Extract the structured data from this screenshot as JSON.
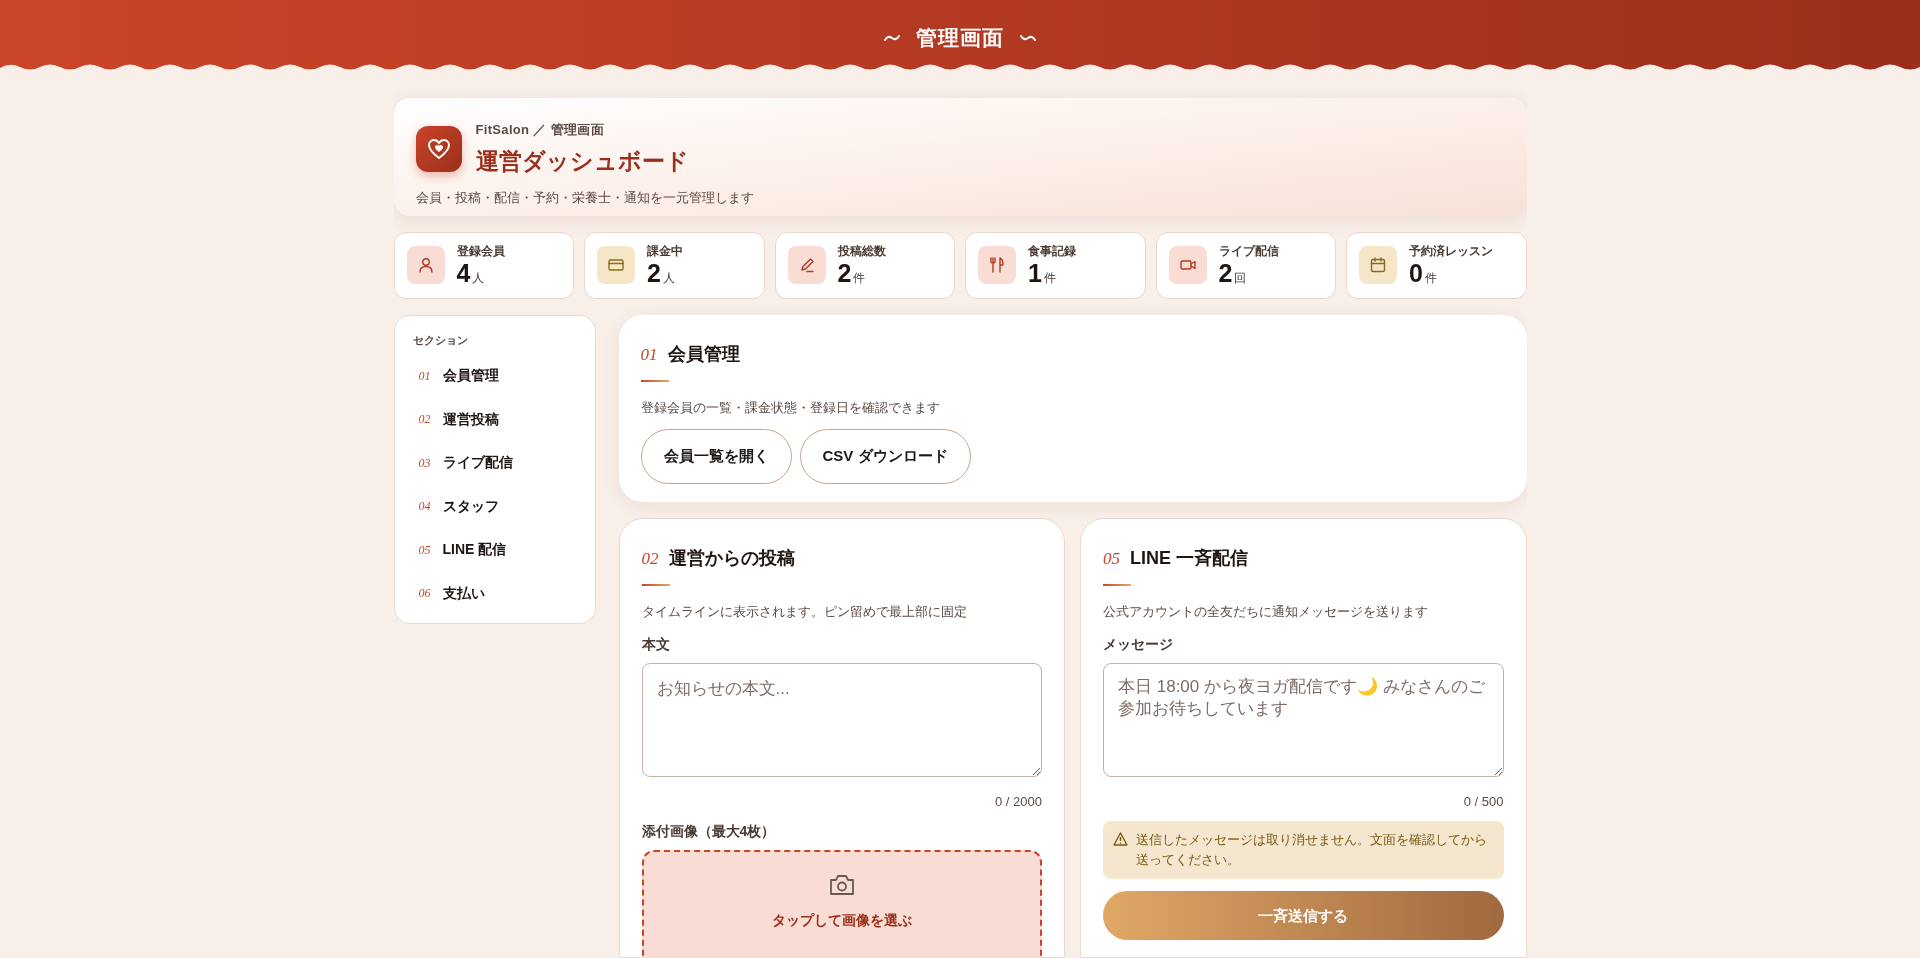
{
  "header": {
    "title": "管理画面"
  },
  "overview": {
    "breadcrumb": "FitSalon ／ 管理画面",
    "title": "運営ダッシュボード",
    "subtitle": "会員・投稿・配信・予約・栄養士・通知を一元管理します"
  },
  "stats": [
    {
      "label": "登録会員",
      "value": "4",
      "unit": "人"
    },
    {
      "label": "課金中",
      "value": "2",
      "unit": "人"
    },
    {
      "label": "投稿総数",
      "value": "2",
      "unit": "件"
    },
    {
      "label": "食事記録",
      "value": "1",
      "unit": "件"
    },
    {
      "label": "ライブ配信",
      "value": "2",
      "unit": "回"
    },
    {
      "label": "予約済レッスン",
      "value": "0",
      "unit": "件"
    }
  ],
  "sidebar": {
    "heading": "セクション",
    "items": [
      {
        "number": "01",
        "label": "会員管理"
      },
      {
        "number": "02",
        "label": "運営投稿"
      },
      {
        "number": "03",
        "label": "ライブ配信"
      },
      {
        "number": "04",
        "label": "スタッフ"
      },
      {
        "number": "05",
        "label": "LINE 配信"
      },
      {
        "number": "06",
        "label": "支払い"
      }
    ]
  },
  "members_section": {
    "number": "01",
    "title": "会員管理",
    "description": "登録会員の一覧・課金状態・登録日を確認できます",
    "buttons": [
      "会員一覧を開く",
      "CSV ダウンロード"
    ]
  },
  "post_section": {
    "number": "02",
    "title": "運営からの投稿",
    "description": "タイムラインに表示されます。ピン留めで最上部に固定",
    "body_label": "本文",
    "body_placeholder": "お知らせの本文...",
    "counter": "0 / 2000",
    "attach_label": "添付画像（最大4枚）",
    "dropzone_label": "タップして画像を選ぶ"
  },
  "line_section": {
    "number": "05",
    "title": "LINE 一斉配信",
    "description": "公式アカウントの全友だちに通知メッセージを送ります",
    "message_label": "メッセージ",
    "message_placeholder": "本日 18:00 から夜ヨガ配信です🌙 みなさんのご参加お待ちしています",
    "counter": "0 / 500",
    "warning": "送信したメッセージは取り消せません。文面を確認してから送ってください。",
    "send_button": "一斉送信する"
  }
}
